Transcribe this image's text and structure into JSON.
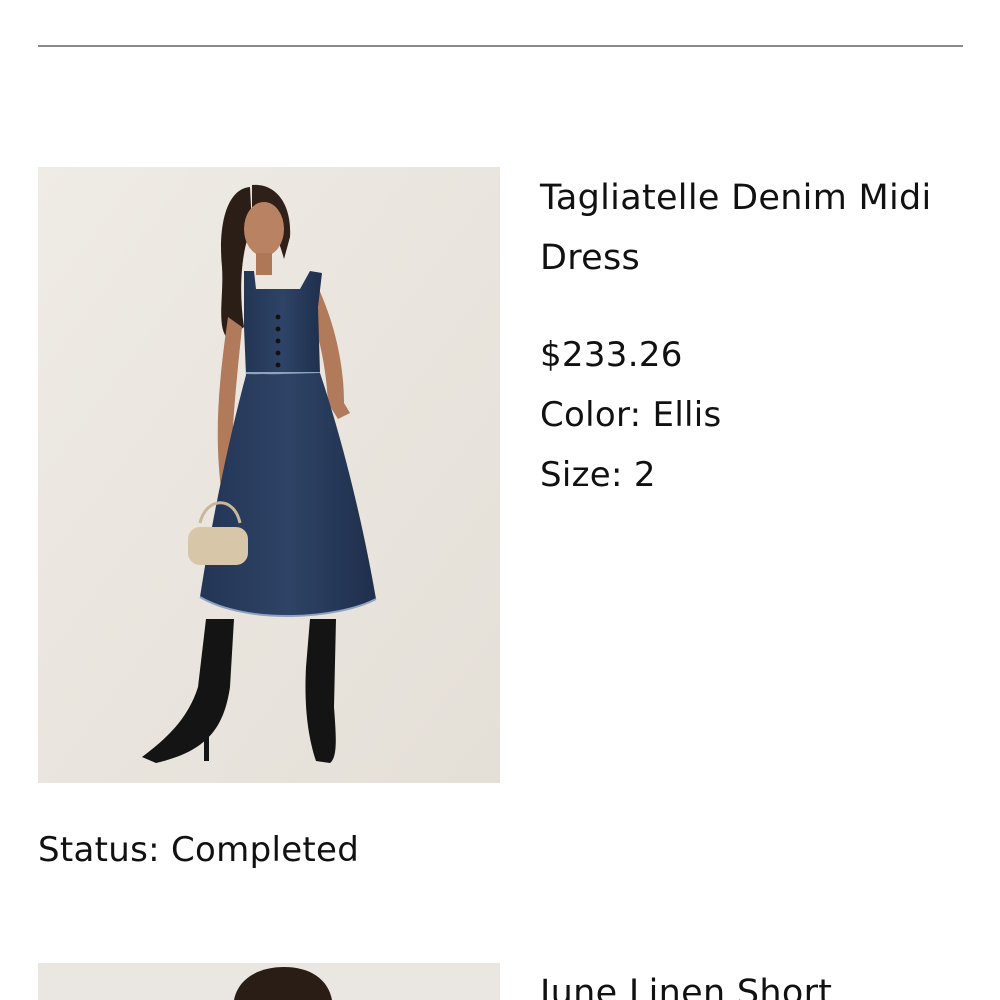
{
  "orders": [
    {
      "image_alt": "Model wearing denim midi dress",
      "title": "Tagliatelle Denim Midi Dress",
      "price": "$233.26",
      "color": "Color: Ellis",
      "size": "Size: 2",
      "status": "Status: Completed"
    },
    {
      "image_alt": "Model wearing linen short",
      "title": "June Linen Short"
    }
  ],
  "colors": {
    "divider": "#8a8a8a",
    "text": "#111111",
    "image_background": "#ece8e1",
    "denim": "#2b3d5e"
  }
}
